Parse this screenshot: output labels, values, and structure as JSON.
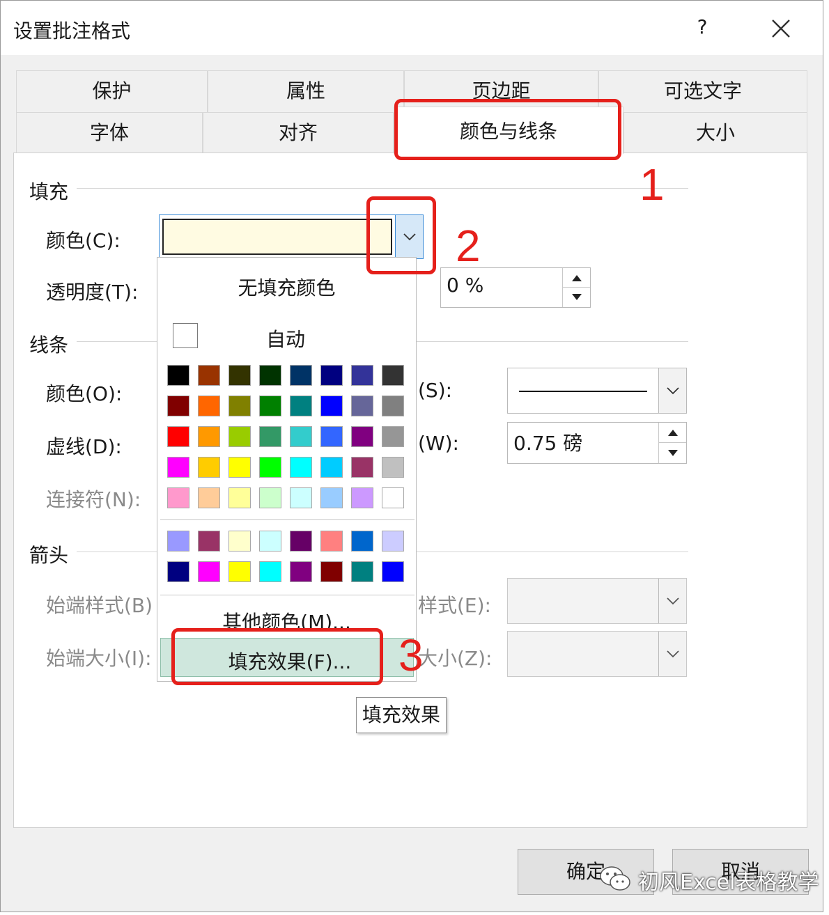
{
  "dialog": {
    "title": "设置批注格式",
    "help": "?",
    "close": "×"
  },
  "tabs": {
    "row1": [
      "保护",
      "属性",
      "页边距",
      "可选文字"
    ],
    "row2": [
      "字体",
      "对齐",
      "颜色与线条",
      "大小"
    ]
  },
  "fill": {
    "section": "填充",
    "color_label": "颜色(C):",
    "color_value": "#fffbe2",
    "transparency_label": "透明度(T):",
    "transparency_value": "0 %"
  },
  "line": {
    "section": "线条",
    "color_label": "颜色(O):",
    "dash_label": "虚线(D):",
    "connector_label": "连接符(N):",
    "style_label": "(S):",
    "weight_label": "(W):",
    "weight_value": "0.75 磅"
  },
  "arrow": {
    "section": "箭头",
    "begin_style_label": "始端样式(B)",
    "begin_size_label": "始端大小(I):",
    "end_style_label": "样式(E):",
    "end_size_label": "大小(Z):"
  },
  "dropdown": {
    "no_fill": "无填充颜色",
    "auto": "自动",
    "palette_main": [
      [
        "#000000",
        "#993300",
        "#333300",
        "#003300",
        "#003366",
        "#000080",
        "#333399",
        "#333333"
      ],
      [
        "#800000",
        "#ff6600",
        "#808000",
        "#008000",
        "#008080",
        "#0000ff",
        "#666699",
        "#808080"
      ],
      [
        "#ff0000",
        "#ff9900",
        "#99cc00",
        "#339966",
        "#33cccc",
        "#3366ff",
        "#800080",
        "#969696"
      ],
      [
        "#ff00ff",
        "#ffcc00",
        "#ffff00",
        "#00ff00",
        "#00ffff",
        "#00ccff",
        "#993366",
        "#c0c0c0"
      ],
      [
        "#ff99cc",
        "#ffcc99",
        "#ffff99",
        "#ccffcc",
        "#ccffff",
        "#99ccff",
        "#cc99ff",
        "#ffffff"
      ]
    ],
    "palette_extra": [
      [
        "#9999ff",
        "#993366",
        "#ffffcc",
        "#ccffff",
        "#660066",
        "#ff8080",
        "#0066cc",
        "#ccccff"
      ],
      [
        "#000080",
        "#ff00ff",
        "#ffff00",
        "#00ffff",
        "#800080",
        "#800000",
        "#008080",
        "#0000ff"
      ]
    ],
    "more_colors": "其他颜色(M)...",
    "fill_effect": "填充效果(F)..."
  },
  "tooltip": "填充效果",
  "buttons": {
    "ok": "确定",
    "cancel": "取消"
  },
  "annotations": [
    "1",
    "2",
    "3"
  ],
  "watermark": "初风Excel表格教学",
  "accent_color": "#e5201b"
}
